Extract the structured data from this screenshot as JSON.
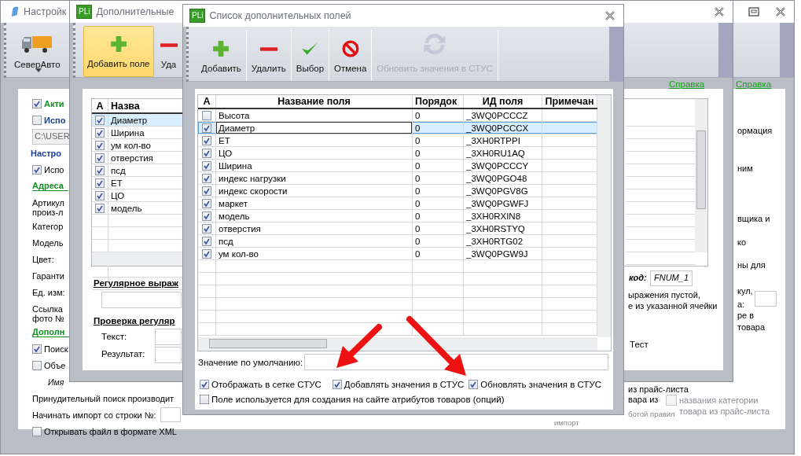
{
  "settings_window": {
    "title": "Настройк",
    "toolbar": [
      {
        "label": "СеверАвто",
        "kind": "truck"
      }
    ],
    "help_link": "Справка",
    "left_items": [
      {
        "kind": "check",
        "label": "Акти",
        "checked": true,
        "color": "#0f8f1f"
      },
      {
        "kind": "check",
        "label": "Испо",
        "checked": false,
        "color": "#1a3f9a"
      },
      {
        "kind": "field",
        "value": "C:\\USER"
      },
      {
        "kind": "heading",
        "label": "Настро",
        "color": "#1a3f9a"
      },
      {
        "kind": "check",
        "label": "Испо",
        "checked": true
      },
      {
        "kind": "section",
        "label": "Адреса",
        "color": "#0f8f1f"
      },
      {
        "kind": "label",
        "label": "Артикул"
      },
      {
        "kind": "cont",
        "label": "произ-л"
      },
      {
        "kind": "label",
        "label": "Категор"
      },
      {
        "kind": "label",
        "label": "Модель"
      },
      {
        "kind": "label",
        "label": "Цвет:"
      },
      {
        "kind": "label",
        "label": "Гаранти"
      },
      {
        "kind": "label",
        "label": "Ед. изм:"
      },
      {
        "kind": "label",
        "label": "Ссылка"
      },
      {
        "kind": "cont",
        "label": "фото №"
      },
      {
        "kind": "section",
        "label": "Дополн",
        "color": "#0f8f1f"
      },
      {
        "kind": "check",
        "label": "Поиск",
        "checked": true
      },
      {
        "kind": "check",
        "label": "Объе",
        "checked": false
      },
      {
        "kind": "italic",
        "label": "Имя"
      },
      {
        "kind": "label",
        "label": "Принудительный поиск производит"
      },
      {
        "kind": "fieldrow",
        "label": "Начинать импорт со строки №:"
      },
      {
        "kind": "check",
        "label": "Открывать файл в формате XML",
        "checked": false
      }
    ],
    "right_items": [
      {
        "kind": "label",
        "label": "ормация"
      },
      {
        "kind": "label",
        "label": "ним"
      },
      {
        "kind": "label",
        "label": "вщика и"
      },
      {
        "kind": "label",
        "label": "ко"
      },
      {
        "kind": "label",
        "label": "ны для"
      },
      {
        "kind": "label",
        "label": "кул,"
      },
      {
        "kind": "fieldrow",
        "label": "а:"
      },
      {
        "kind": "label",
        "label": "ре в"
      },
      {
        "kind": "label",
        "label": "товара"
      }
    ],
    "bottom_group": {
      "lines": [
        "из прайс-листа",
        "вара из"
      ],
      "option": {
        "label": "названия  категории товара из прайс-листа",
        "checked": false,
        "disabled": true
      },
      "note": "ботой правил",
      "footer": "импорт"
    }
  },
  "fields_window": {
    "logo": "PLi",
    "title": "Дополнительные",
    "toolbar": [
      {
        "label": "Добавить поле",
        "kind": "add",
        "selected": true
      },
      {
        "label": "Уда",
        "kind": "remove",
        "selected": false
      }
    ],
    "help_link": "Справка",
    "grid": {
      "columns": [
        "A",
        "Назва"
      ],
      "rows": [
        {
          "name": "Диаметр",
          "checked": true,
          "selected": true
        },
        {
          "name": "Ширина",
          "checked": true,
          "selected": false
        },
        {
          "name": "ум кол-во",
          "checked": true,
          "selected": false
        },
        {
          "name": "отверстия",
          "checked": true,
          "selected": false
        },
        {
          "name": "псд",
          "checked": true,
          "selected": false
        },
        {
          "name": "ЕТ",
          "checked": true,
          "selected": false
        },
        {
          "name": "ЦО",
          "checked": true,
          "selected": false
        },
        {
          "name": "модель",
          "checked": true,
          "selected": false
        }
      ]
    },
    "regex_title": "Регулярное выраж",
    "check_title": "Проверка регуляр",
    "text_label": "Текст:",
    "result_label": "Результат:",
    "code_label": "код:",
    "code_value": "FNUM_1",
    "note_lines": [
      "ыражения пустой,",
      "е из указанной ячейки"
    ],
    "test_label": "Тест"
  },
  "list_window": {
    "logo": "PLi",
    "title": "Список дополнительных полей",
    "toolbar": [
      {
        "label": "Добавить",
        "kind": "add",
        "disabled": false
      },
      {
        "label": "Удалить",
        "kind": "remove",
        "disabled": false
      },
      {
        "label": "Выбор",
        "kind": "confirm",
        "disabled": false
      },
      {
        "label": "Отмена",
        "kind": "cancel",
        "disabled": false
      },
      {
        "label": "Обновить значения в СТУС",
        "kind": "refresh",
        "disabled": true
      }
    ],
    "grid": {
      "columns": [
        "A",
        "Название поля",
        "Порядок",
        "ИД поля",
        "Примечан"
      ],
      "rows": [
        {
          "checked": false,
          "selected": false,
          "name": "Высота",
          "order": "0",
          "id": "_3WQ0PCCCZ"
        },
        {
          "checked": true,
          "selected": true,
          "name": "Диаметр",
          "order": "0",
          "id": "_3WQ0PCCCX"
        },
        {
          "checked": true,
          "selected": false,
          "name": "ЕТ",
          "order": "0",
          "id": "_3XH0RTPPI"
        },
        {
          "checked": true,
          "selected": false,
          "name": "ЦО",
          "order": "0",
          "id": "_3XH0RU1AQ"
        },
        {
          "checked": true,
          "selected": false,
          "name": "Ширина",
          "order": "0",
          "id": "_3WQ0PCCCY"
        },
        {
          "checked": true,
          "selected": false,
          "name": "индекс нагрузки",
          "order": "0",
          "id": "_3WQ0PGO48"
        },
        {
          "checked": true,
          "selected": false,
          "name": "индекс скорости",
          "order": "0",
          "id": "_3WQ0PGV8G"
        },
        {
          "checked": true,
          "selected": false,
          "name": "маркет",
          "order": "0",
          "id": "_3WQ0PGWFJ"
        },
        {
          "checked": true,
          "selected": false,
          "name": "модель",
          "order": "0",
          "id": "_3XH0RXIN8"
        },
        {
          "checked": true,
          "selected": false,
          "name": "отверстия",
          "order": "0",
          "id": "_3XH0RSTYQ"
        },
        {
          "checked": true,
          "selected": false,
          "name": "псд",
          "order": "0",
          "id": "_3XH0RTG02"
        },
        {
          "checked": true,
          "selected": false,
          "name": "ум кол-во",
          "order": "0",
          "id": "_3WQ0PGW9J"
        }
      ]
    },
    "default_label": "Значение по умолчанию:",
    "options": [
      {
        "label": "Отображать в сетке СТУС",
        "checked": true
      },
      {
        "label": "Добавлять значения в СТУС",
        "checked": true
      },
      {
        "label": "Обновлять значения в СТУС",
        "checked": true
      },
      {
        "label": "Поле используется для создания на сайте атрибутов товаров (опций)",
        "checked": false
      }
    ]
  }
}
